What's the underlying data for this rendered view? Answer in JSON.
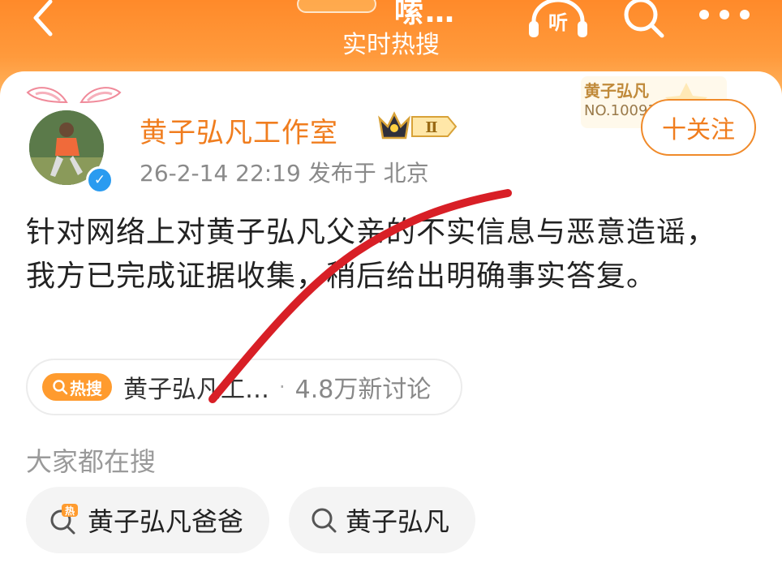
{
  "header": {
    "title": "嗦…",
    "subtitle": "实时热搜",
    "listen_label": "听"
  },
  "post": {
    "author": "黄子弘凡工作室",
    "vip_level": "Ⅱ",
    "meta": "26-2-14 22:19  发布于 北京",
    "verified": "✓",
    "fan_badge_title": "黄子弘凡",
    "fan_badge_no": "NO.10093",
    "follow_label": "十关注",
    "text": "针对网络上对黄子弘凡父亲的不实信息与恶意造谣，我方已完成证据收集，稍后给出明确事实答复。"
  },
  "hot_search": {
    "tag": "热搜",
    "topic": "黄子弘凡工…",
    "count": "4.8万新讨论"
  },
  "suggest": {
    "label": "大家都在搜",
    "items": [
      {
        "text": "黄子弘凡爸爸",
        "icon": "hot-search-icon"
      },
      {
        "text": "黄子弘凡",
        "icon": "search-icon"
      }
    ]
  },
  "colors": {
    "accent": "#f07d1e",
    "header": "#ff8a2a",
    "hot_tag": "#ff9b2e",
    "verify": "#2a9bf0",
    "red_stroke": "#d81f26"
  }
}
